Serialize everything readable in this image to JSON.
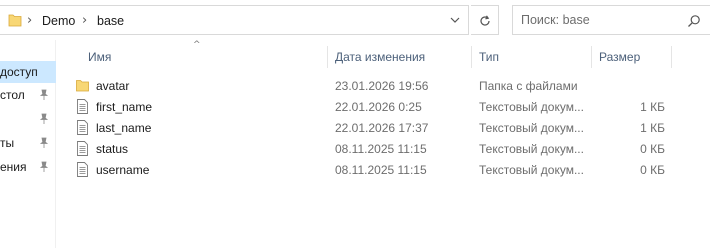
{
  "address_bar": {
    "crumbs": [
      "Demo",
      "base"
    ]
  },
  "search": {
    "placeholder": "Поиск: base"
  },
  "nav": {
    "items": [
      {
        "label": "доступ",
        "pinned": false,
        "selected": true
      },
      {
        "label": "стол",
        "pinned": true,
        "selected": false
      },
      {
        "label": "",
        "pinned": true,
        "selected": false
      },
      {
        "label": "ты",
        "pinned": true,
        "selected": false
      },
      {
        "label": "ения",
        "pinned": true,
        "selected": false
      }
    ]
  },
  "columns": {
    "name": "Имя",
    "date": "Дата изменения",
    "type": "Тип",
    "size": "Размер"
  },
  "files": [
    {
      "name": "avatar",
      "date": "23.01.2026 19:56",
      "type": "Папка с файлами",
      "size": "",
      "icon": "folder-icon"
    },
    {
      "name": "first_name",
      "date": "22.01.2026 0:25",
      "type": "Текстовый докум...",
      "size": "1 КБ",
      "icon": "text-file-icon"
    },
    {
      "name": "last_name",
      "date": "22.01.2026 17:37",
      "type": "Текстовый докум...",
      "size": "1 КБ",
      "icon": "text-file-icon"
    },
    {
      "name": "status",
      "date": "08.11.2025 11:15",
      "type": "Текстовый докум...",
      "size": "0 КБ",
      "icon": "text-file-icon"
    },
    {
      "name": "username",
      "date": "08.11.2025 11:15",
      "type": "Текстовый докум...",
      "size": "0 КБ",
      "icon": "text-file-icon"
    }
  ],
  "colors": {
    "folder": "#f8d775",
    "selection": "#cce8ff",
    "header_text": "#4c607a"
  }
}
